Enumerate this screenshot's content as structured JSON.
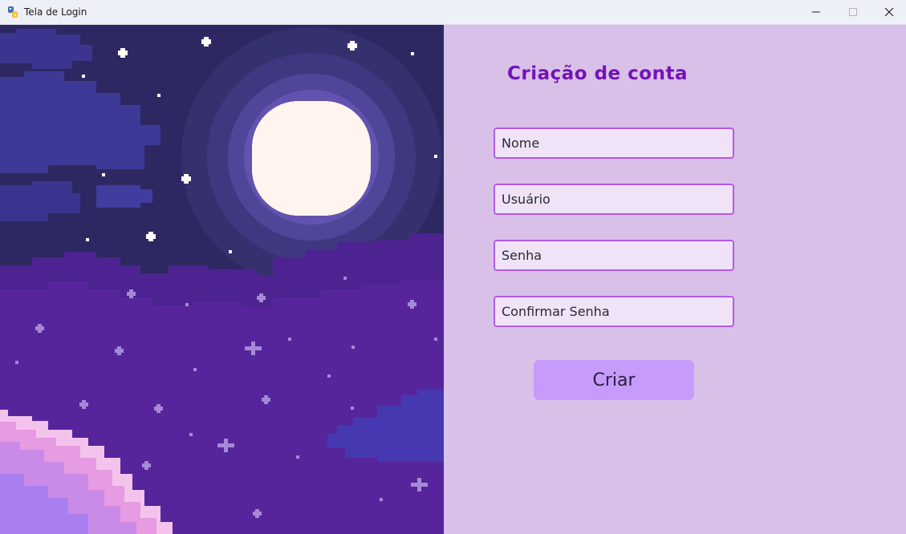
{
  "window": {
    "title": "Tela de Login",
    "app_icon": "python-icon",
    "controls": {
      "minimize": "minimize-icon",
      "maximize": "maximize-icon",
      "close": "close-icon"
    }
  },
  "form": {
    "title": "Criação de conta",
    "fields": {
      "nome": {
        "placeholder": "Nome",
        "value": ""
      },
      "usuario": {
        "placeholder": "Usuário",
        "value": ""
      },
      "senha": {
        "placeholder": "Senha",
        "value": ""
      },
      "confirmar": {
        "placeholder": "Confirmar Senha",
        "value": ""
      }
    },
    "submit_label": "Criar"
  },
  "colors": {
    "panel_bg": "#d9c0e9",
    "title": "#7412b8",
    "field_border": "#b25ae6",
    "field_bg": "#f0e3f8",
    "button_bg": "#c79bfb",
    "sky_dark": "#2f2a63",
    "sky_purple": "#56259a",
    "moon": "#fff5ee"
  }
}
